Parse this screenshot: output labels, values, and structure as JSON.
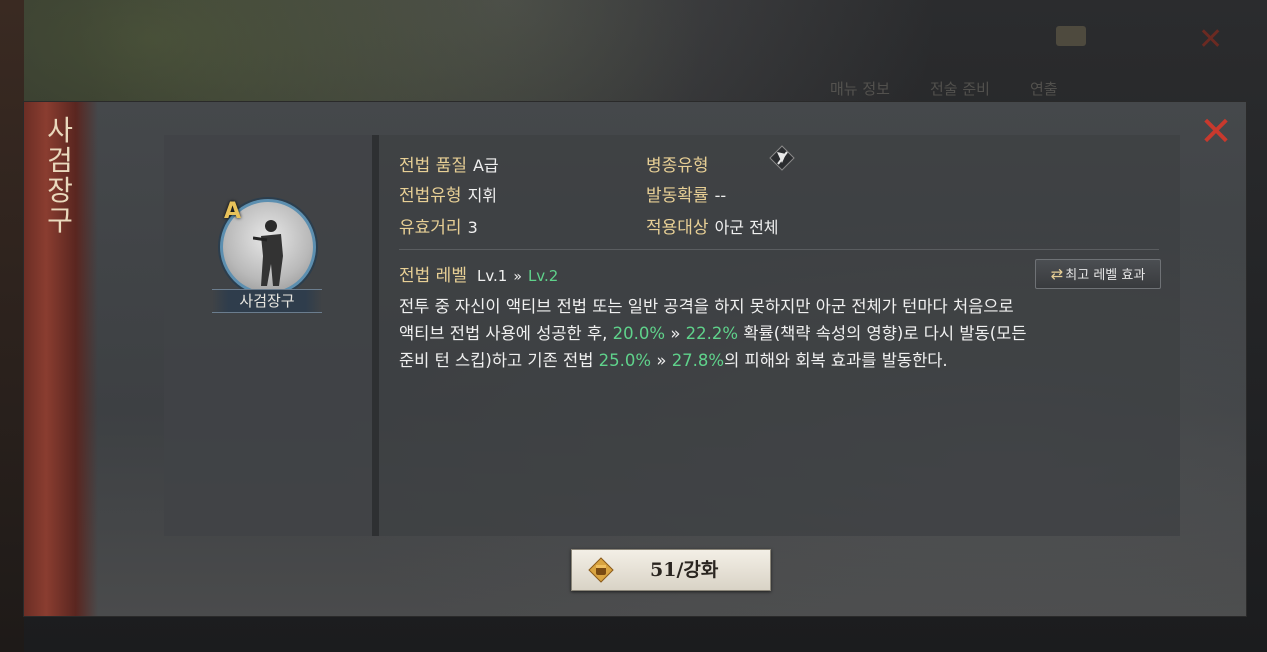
{
  "dialog": {
    "title": "사검장구",
    "close_symbol": "✕"
  },
  "portrait": {
    "grade": "A",
    "name": "사검장구"
  },
  "attributes": {
    "quality_label": "전법 품질",
    "quality_value": "A급",
    "type_label": "전법유형",
    "type_value": "지휘",
    "range_label": "유효거리",
    "range_value": "3",
    "troop_label": "병종유형",
    "troop_icon": "troop-type-icon",
    "trigger_label": "발동확률",
    "trigger_value": "--",
    "target_label": "적용대상",
    "target_value": "아군 전체"
  },
  "level": {
    "label": "전법 레벨",
    "current": "Lv.1",
    "arrow": "»",
    "next": "Lv.2",
    "max_button": "최고 레벨 효과"
  },
  "description": {
    "p1": "전투 중 자신이 액티브 전법 또는 일반 공격을 하지 못하지만 아군 전체가 턴마다 처음으로",
    "p2a": " 액티브 전법 사용에 성공한 후, ",
    "v1": "20.0%",
    "arrow": "»",
    "v2": "22.2%",
    "p2b": " 확률(책략 속성의 영향)로 다시 발동(모든",
    "p3a": "준비 턴 스킵)하고 기존 전법 ",
    "v3": "25.0%",
    "v4": "27.8%",
    "p3b": "의 피해와 회복 효과를 발동한다."
  },
  "enhance": {
    "label": "51/강화"
  },
  "background": {
    "tabs": [
      "매뉴 정보",
      "전술 준비",
      "연출"
    ]
  },
  "colors": {
    "highlight": "#5fd28b",
    "label_gold": "#e7cf95",
    "close_red": "#c8392d"
  }
}
